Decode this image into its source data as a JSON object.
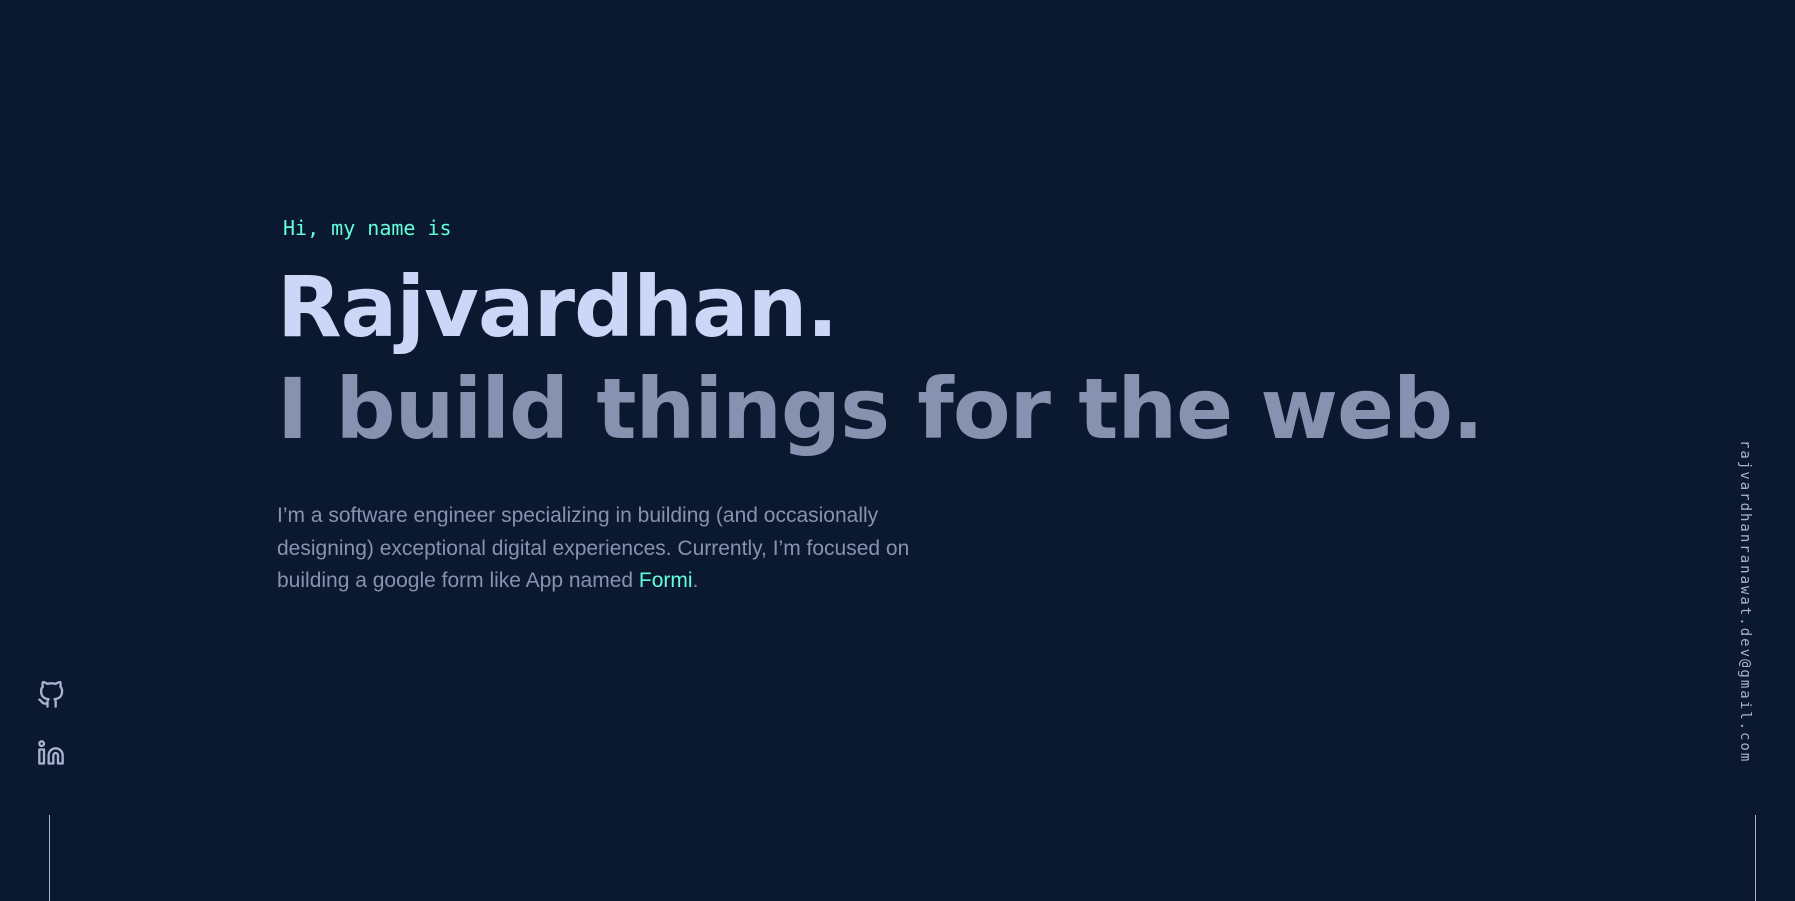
{
  "hero": {
    "greeting": "Hi, my name is",
    "name": "Rajvardhan.",
    "tagline": "I build things for the web.",
    "intro_text": "I’m a software engineer specializing in building (and occasionally designing) exceptional digital experiences. Currently, I’m focused on building a google form like App named ",
    "project_link": "Formi",
    "intro_end": "."
  },
  "social": {
    "items": [
      {
        "icon": "github-icon"
      },
      {
        "icon": "linkedin-icon"
      }
    ]
  },
  "contact": {
    "email": "rajvardhanranawat.dev@gmail.com"
  },
  "colors": {
    "background": "#0a192f",
    "accent": "#64ffda",
    "heading": "#ccd6f6",
    "text": "#8892b0",
    "light": "#a8b2d1"
  }
}
